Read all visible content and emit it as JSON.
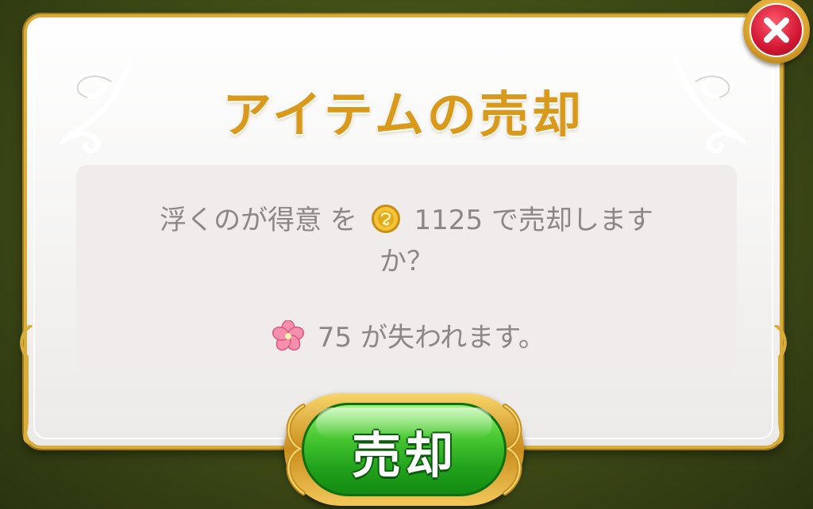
{
  "dialog": {
    "title": "アイテムの売却",
    "message": {
      "line1_prefix": "浮くのが得意 を",
      "coin_amount": "1125",
      "line1_suffix": "で売却します",
      "line2": "か？",
      "flower_amount": "75",
      "line3_suffix": "が失われます。"
    },
    "sell_button_label": "売却",
    "close_icon": "close-icon"
  },
  "icons": {
    "coin": "gold-coin-icon",
    "flower": "pink-flower-icon",
    "close": "close-icon"
  },
  "colors": {
    "title": "#d9991a",
    "panel_border": "#d9ad3c",
    "sell_button": "#2fb324",
    "close_button": "#d21733",
    "message_text": "#8b8784"
  }
}
